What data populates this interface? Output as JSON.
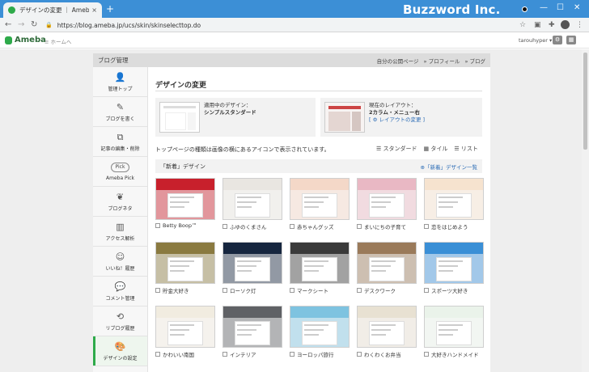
{
  "browser": {
    "tab_title": "デザインの変更 ｜ Ameba (アメーバ)",
    "tab_close": "×",
    "new_tab": "+",
    "url": "https://blog.ameba.jp/ucs/skin/skinselecttop.do",
    "watermark": "Buzzword Inc.",
    "window_controls": [
      "—",
      "☐",
      "✕"
    ]
  },
  "ameba_header": {
    "logo_text": "Ameba",
    "home_link": "≡ ホームへ",
    "username": "tarouhyper ▾"
  },
  "panel": {
    "title": "ブログ管理",
    "header_links": [
      "自分の公開ページ",
      "» プロフィール",
      "» ブログ"
    ]
  },
  "sidebar": {
    "items": [
      {
        "label": "管理トップ",
        "icon": "person-icon",
        "glyph": "👤"
      },
      {
        "label": "ブログを書く",
        "icon": "pen-icon",
        "glyph": "✎"
      },
      {
        "label": "記事の編集・削除",
        "icon": "documents-icon",
        "glyph": "⧉"
      },
      {
        "label": "Ameba Pick",
        "icon": "pick-badge",
        "glyph": "Pick"
      },
      {
        "label": "ブログネタ",
        "icon": "sprout-icon",
        "glyph": "❦"
      },
      {
        "label": "アクセス解析",
        "icon": "bar-chart-icon",
        "glyph": "▥"
      },
      {
        "label": "いいね！履歴",
        "icon": "smile-icon",
        "glyph": "☺"
      },
      {
        "label": "コメント管理",
        "icon": "comment-icon",
        "glyph": "💬"
      },
      {
        "label": "リブログ履歴",
        "icon": "reblog-icon",
        "glyph": "⟲"
      },
      {
        "label": "デザインの設定",
        "icon": "palette-icon",
        "glyph": "🎨"
      }
    ]
  },
  "main": {
    "title": "デザインの変更",
    "current_design": {
      "label": "適用中のデザイン：",
      "name": "シンプルスタンダード"
    },
    "current_layout": {
      "label": "現在のレイアウト：",
      "name": "2カラム・メニュー右",
      "link": "[ ⚙ レイアウトの変更 ]"
    },
    "notice": "トップページの種類は画像の横にあるアイコンで表示されています。",
    "views": [
      "☰ スタンダード",
      "▦ タイル",
      "☰ リスト"
    ],
    "section": {
      "title": "「新着」デザイン",
      "link": "⊕「新着」デザイン一覧"
    },
    "designs": [
      {
        "name": "Betty Boop™",
        "color": "#c8202c"
      },
      {
        "name": "ふゆのくまさん",
        "color": "#e9e6e1"
      },
      {
        "name": "赤ちゃんグッズ",
        "color": "#f4d8c8"
      },
      {
        "name": "まいにちの子育て",
        "color": "#e9b8c4"
      },
      {
        "name": "恋をはじめよう",
        "color": "#f6e3cf"
      },
      {
        "name": "貯金大好き",
        "color": "#8a7a40"
      },
      {
        "name": "ローソク灯",
        "color": "#16263f"
      },
      {
        "name": "マークシート",
        "color": "#3a3a3a"
      },
      {
        "name": "デスクワーク",
        "color": "#9a7a5a"
      },
      {
        "name": "スポーツ大好き",
        "color": "#3a8fd6"
      },
      {
        "name": "かわいい南国",
        "color": "#f1ece0"
      },
      {
        "name": "インテリア",
        "color": "#5f6165"
      },
      {
        "name": "ヨーロッパ旅行",
        "color": "#7ec3e0"
      },
      {
        "name": "わくわくお弁当",
        "color": "#e8e1d2"
      },
      {
        "name": "大好きハンドメイド",
        "color": "#eaf3ea"
      }
    ]
  }
}
